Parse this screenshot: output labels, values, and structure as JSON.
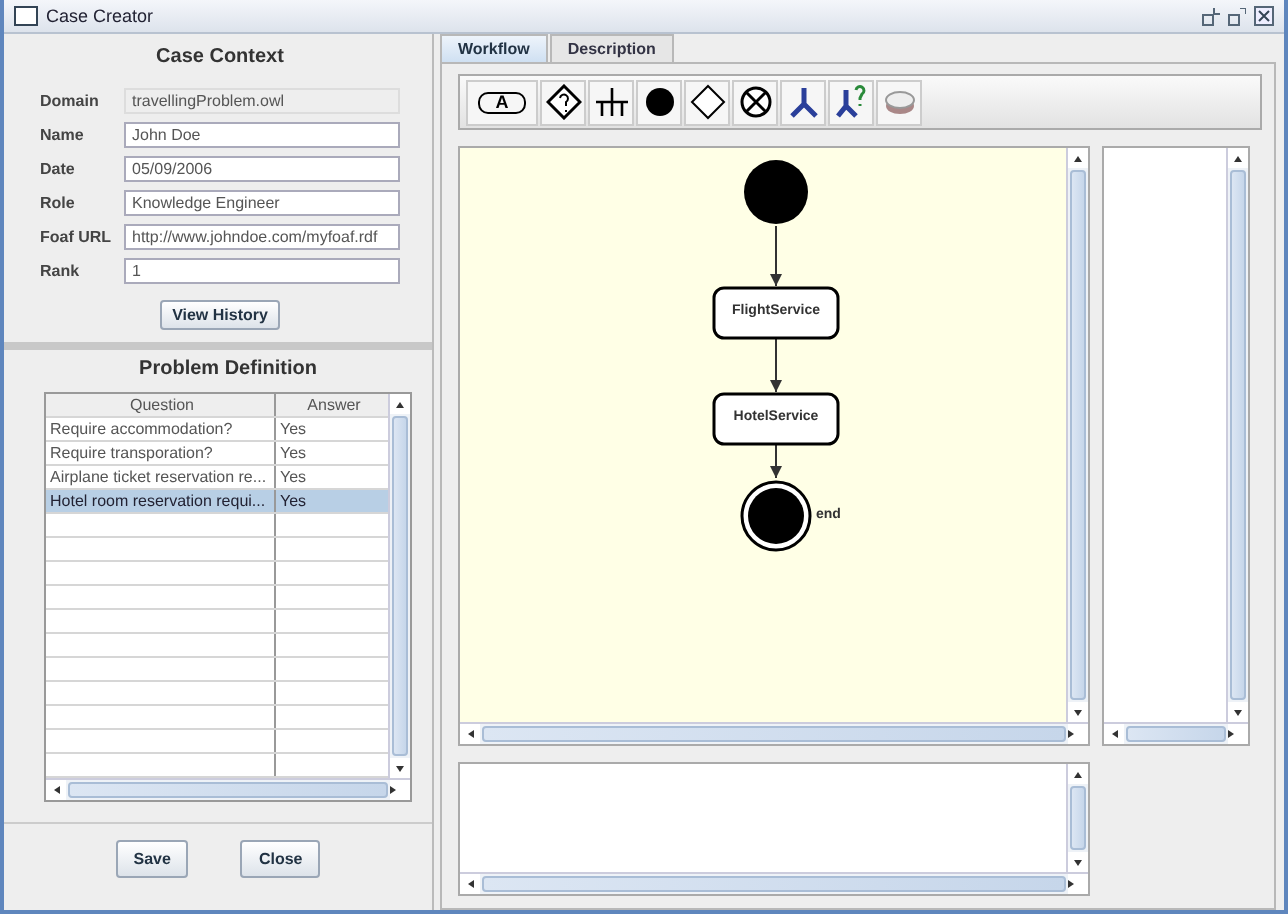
{
  "window": {
    "title": "Case Creator"
  },
  "case_context": {
    "title": "Case Context",
    "fields": [
      {
        "label": "Domain",
        "value": "travellingProblem.owl",
        "disabled": true
      },
      {
        "label": "Name",
        "value": "John Doe",
        "disabled": false
      },
      {
        "label": "Date",
        "value": "05/09/2006",
        "disabled": false
      },
      {
        "label": "Role",
        "value": "Knowledge Engineer",
        "disabled": false
      },
      {
        "label": "Foaf URL",
        "value": "http://www.johndoe.com/myfoaf.rdf",
        "disabled": false
      },
      {
        "label": "Rank",
        "value": "1",
        "disabled": false
      }
    ],
    "button": "View History"
  },
  "problem_definition": {
    "title": "Problem Definition",
    "columns": [
      "Question",
      "Answer"
    ],
    "rows": [
      {
        "question": "Require accommodation?",
        "answer": "Yes",
        "selected": false
      },
      {
        "question": "Require transporation?",
        "answer": "Yes",
        "selected": false
      },
      {
        "question": "Airplane ticket reservation re...",
        "answer": "Yes",
        "selected": false
      },
      {
        "question": "Hotel room reservation requi...",
        "answer": "Yes",
        "selected": true
      }
    ]
  },
  "buttons": [
    "Save",
    "Close"
  ],
  "tabs": [
    {
      "label": "Workflow",
      "selected": true
    },
    {
      "label": "Description",
      "selected": false
    }
  ],
  "toolbar": [
    {
      "kind": "activity",
      "label": "A"
    },
    {
      "kind": "decision"
    },
    {
      "kind": "fork"
    },
    {
      "kind": "start"
    },
    {
      "kind": "merge"
    },
    {
      "kind": "end"
    },
    {
      "kind": "connect"
    },
    {
      "kind": "conditional"
    },
    {
      "kind": "eraser"
    }
  ],
  "workflow": {
    "nodes": [
      {
        "kind": "start"
      },
      {
        "kind": "activity",
        "label": "FlightService"
      },
      {
        "kind": "activity",
        "label": "HotelService"
      },
      {
        "kind": "end",
        "label": "end"
      }
    ]
  }
}
